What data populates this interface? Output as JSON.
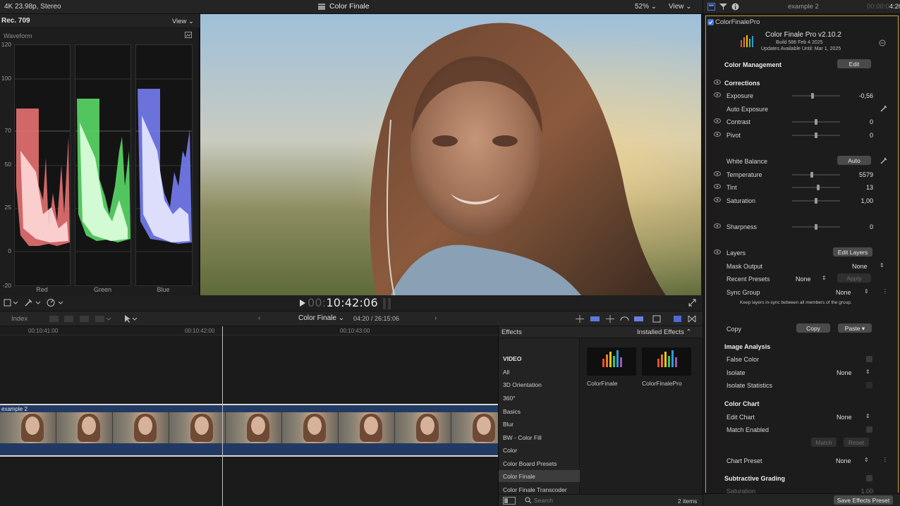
{
  "viewer_bar": {
    "format": "4K 23.98p, Stereo",
    "title": "Color Finale",
    "zoom": "52%",
    "view": "View"
  },
  "scopes": {
    "standard": "Rec. 709",
    "view": "View",
    "type": "Waveform",
    "ticks": [
      "120",
      "100",
      "70",
      "50",
      "25",
      "0",
      "-20"
    ],
    "channels": [
      {
        "name": "Red",
        "color": "#ff6a6a"
      },
      {
        "name": "Green",
        "color": "#66ff77"
      },
      {
        "name": "Blue",
        "color": "#7f86ff"
      }
    ]
  },
  "transport": {
    "timecode_dim": "00:",
    "timecode": "10:42:06"
  },
  "timeline_bar": {
    "index": "Index",
    "project": "Color Finale",
    "duration": "04:20 / 26:15:06"
  },
  "timeline": {
    "ruler": [
      "00:10:41:00",
      "00:10:42:00",
      "00:10:43:00"
    ],
    "clip_name": "example 2"
  },
  "effects": {
    "title": "Effects",
    "installed": "Installed Effects",
    "categories": [
      "VIDEO",
      "All",
      "3D Orientation",
      "360°",
      "Basics",
      "Blur",
      "BW - Color Fill",
      "Color",
      "Color Board Presets",
      "Color Finale",
      "Color Finale Transcoder"
    ],
    "selected": "Color Finale",
    "items": [
      "ColorFinale",
      "ColorFinalePro"
    ],
    "search_placeholder": "Search",
    "count": "2 items"
  },
  "inspector": {
    "clip": "example 2",
    "tc_dim": "00:00:0",
    "tc": "4:20",
    "plugin": "ColorFinalePro",
    "title": "Color Finale Pro v2.10.2",
    "build": "Build 586 Feb  4 2025",
    "updates": "Updates Available Until: Mar 1, 2025",
    "color_management": "Color Management",
    "edit": "Edit",
    "corrections": "Corrections",
    "exposure": {
      "label": "Exposure",
      "value": "-0,56",
      "level": 0.42
    },
    "auto_exposure": "Auto Exposure",
    "contrast": {
      "label": "Contrast",
      "value": "0",
      "level": 0.5
    },
    "pivot": {
      "label": "Pivot",
      "value": "0",
      "level": 0.5
    },
    "white_balance": "White Balance",
    "auto": "Auto",
    "temperature": {
      "label": "Temperature",
      "value": "5579",
      "level": 0.4
    },
    "tint": {
      "label": "Tint",
      "value": "13",
      "level": 0.55
    },
    "saturation": {
      "label": "Saturation",
      "value": "1,00",
      "level": 0.5
    },
    "sharpness": {
      "label": "Sharpness",
      "value": "0",
      "level": 0.5
    },
    "layers": "Layers",
    "edit_layers": "Edit Layers",
    "mask_output": {
      "label": "Mask Output",
      "value": "None"
    },
    "recent_presets": {
      "label": "Recent Presets",
      "value": "None",
      "apply": "Apply"
    },
    "sync_group": {
      "label": "Sync Group",
      "value": "None"
    },
    "keep_note": "Keep layers in-sync between all members of the group.",
    "copy_label": "Copy",
    "copy_btn": "Copy",
    "paste_btn": "Paste",
    "image_analysis": "Image Analysis",
    "false_color": "False Color",
    "isolate": {
      "label": "Isolate",
      "value": "None"
    },
    "isolate_stats": "Isolate Statistics",
    "color_chart": "Color Chart",
    "edit_chart": {
      "label": "Edit Chart",
      "value": "None"
    },
    "match_enabled": "Match Enabled",
    "match_btn": "Match",
    "reset_btn": "Reset",
    "chart_preset": {
      "label": "Chart Preset",
      "value": "None"
    },
    "subtractive": "Subtractive Grading",
    "saturation2": "Saturation",
    "saturation2_value": "1,00",
    "save_preset": "Save Effects Preset"
  }
}
